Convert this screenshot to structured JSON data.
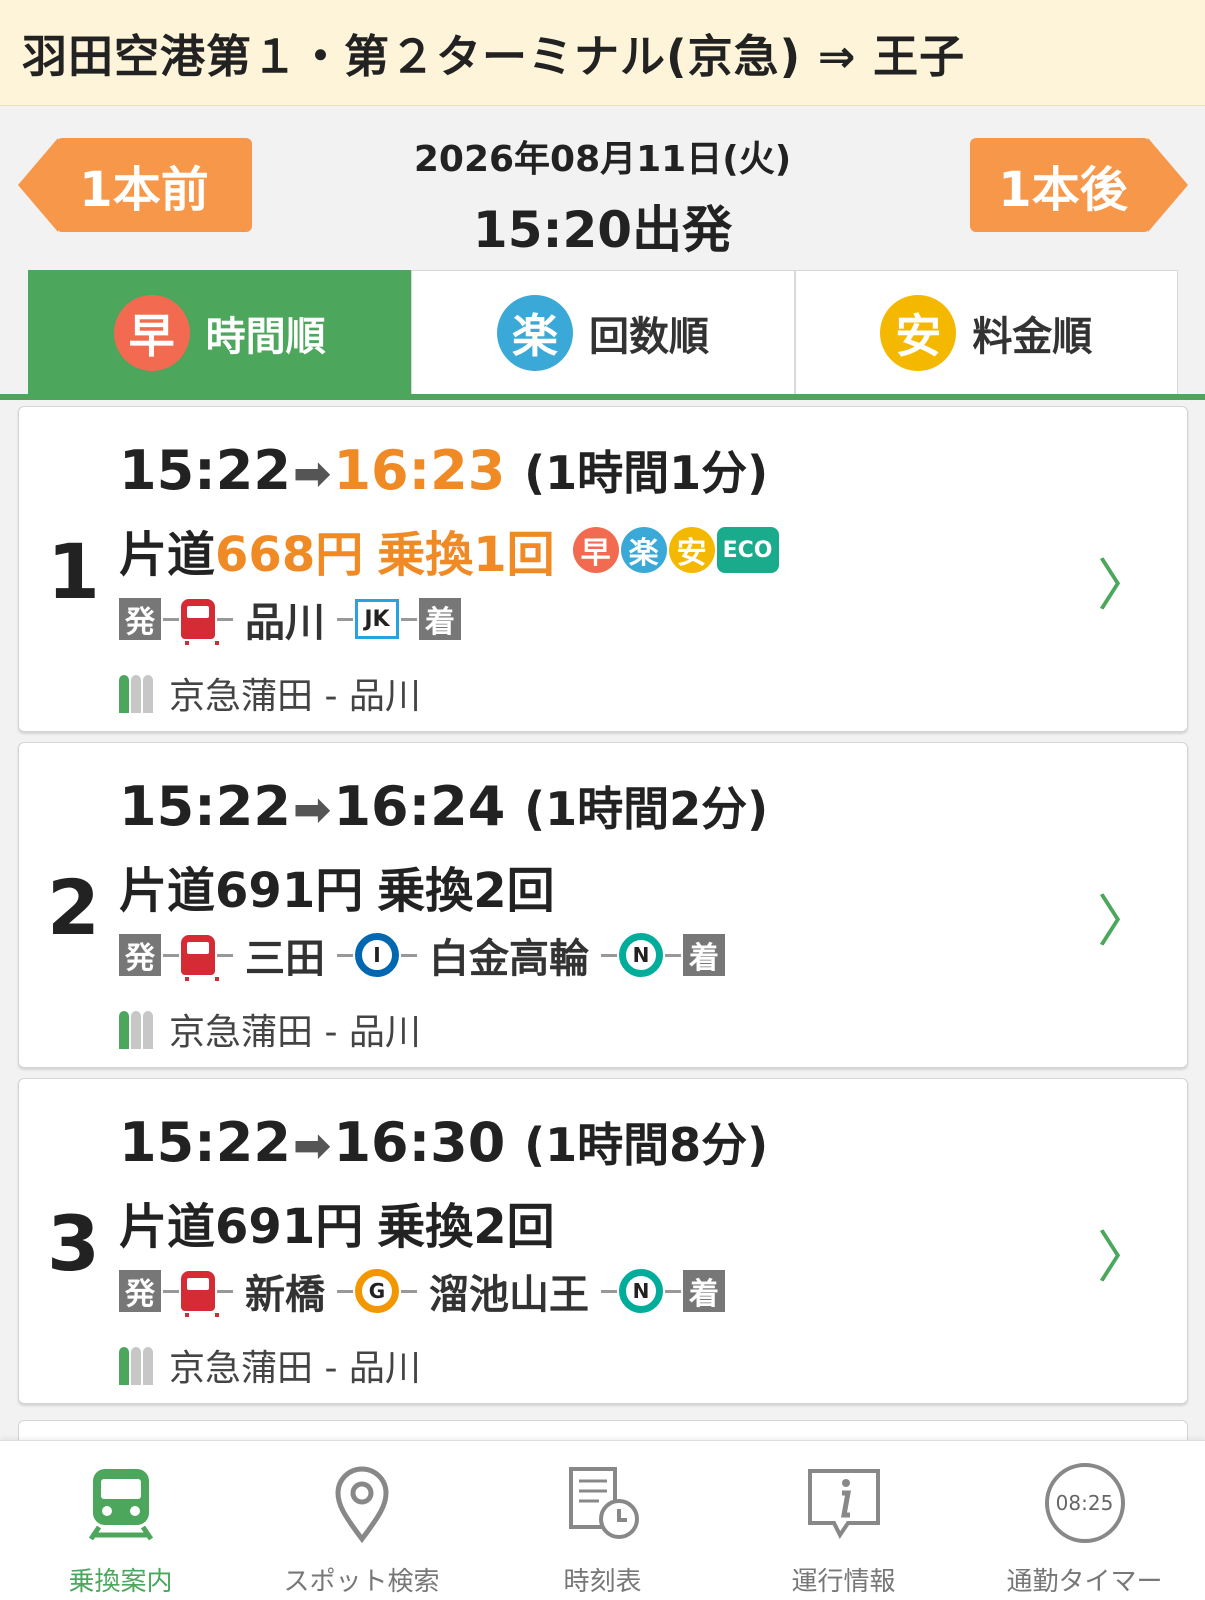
{
  "header": {
    "title": "羽田空港第１・第２ターミナル(京急) ⇒ 王子"
  },
  "nav": {
    "prev_label": "1本前",
    "next_label": "1本後",
    "date": "2026年08月11日(火)",
    "time": "15:20出発"
  },
  "tabs": [
    {
      "badge": "早",
      "label": "時間順",
      "badge_color": "#f26a4f"
    },
    {
      "badge": "楽",
      "label": "回数順",
      "badge_color": "#3aa9d8"
    },
    {
      "badge": "安",
      "label": "料金順",
      "badge_color": "#f5b800"
    }
  ],
  "routes": [
    {
      "rank": "1",
      "depart": "15:22",
      "arrow": "➡",
      "arrive": "16:23",
      "duration": "(1時間1分)",
      "fare_prefix": "片道",
      "fare": "668円",
      "transfers": "乗換1回",
      "badges": [
        "早",
        "楽",
        "安"
      ],
      "eco": "ECO",
      "dep_box": "発",
      "arr_box": "着",
      "stations": [
        "品川"
      ],
      "line_codes": [
        "JK"
      ],
      "via": "京急蒲田 - 品川"
    },
    {
      "rank": "2",
      "depart": "15:22",
      "arrow": "➡",
      "arrive": "16:24",
      "duration": "(1時間2分)",
      "fare_prefix": "片道",
      "fare": "691円",
      "transfers": "乗換2回",
      "dep_box": "発",
      "arr_box": "着",
      "stations": [
        "三田",
        "白金高輪"
      ],
      "line_codes": [
        "I",
        "N"
      ],
      "via": "京急蒲田 - 品川"
    },
    {
      "rank": "3",
      "depart": "15:22",
      "arrow": "➡",
      "arrive": "16:30",
      "duration": "(1時間8分)",
      "fare_prefix": "片道",
      "fare": "691円",
      "transfers": "乗換2回",
      "dep_box": "発",
      "arr_box": "着",
      "stations": [
        "新橋",
        "溜池山王"
      ],
      "line_codes": [
        "G",
        "N"
      ],
      "via": "京急蒲田 - 品川"
    }
  ],
  "bottom_nav": [
    {
      "label": "乗換案内",
      "icon": "train-icon",
      "active": true
    },
    {
      "label": "スポット検索",
      "icon": "map-pin-icon"
    },
    {
      "label": "時刻表",
      "icon": "timetable-icon"
    },
    {
      "label": "運行情報",
      "icon": "info-icon"
    },
    {
      "label": "通勤タイマー",
      "icon": "timer-icon",
      "timer": "08:25"
    }
  ],
  "colors": {
    "accent_green": "#4ca65c",
    "orange": "#f08a24",
    "keikyu_red": "#d42b35",
    "line_I": "#0067b0",
    "line_N": "#00ac9a",
    "line_G": "#f39700",
    "line_JK": "#27a4dc"
  }
}
